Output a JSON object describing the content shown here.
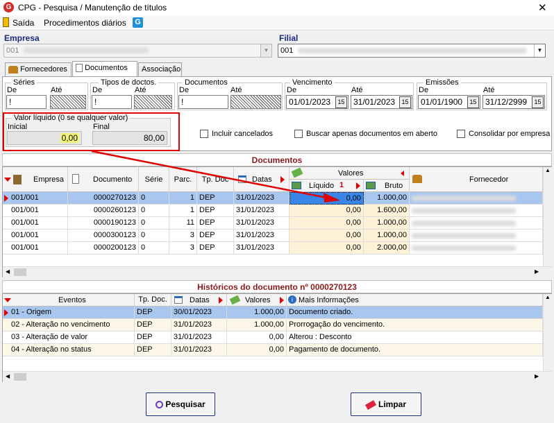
{
  "window": {
    "title": "CPG - Pesquisa / Manutenção de títulos",
    "close": "✕"
  },
  "menu": {
    "exit_label": "Saída",
    "daily_label": "Procedimentos diários"
  },
  "empresa": {
    "label": "Empresa",
    "code": "001"
  },
  "filial": {
    "label": "Filial",
    "code": "001"
  },
  "tabs": [
    {
      "label": "Fornecedores"
    },
    {
      "label": "Documentos"
    },
    {
      "label": "Associação"
    }
  ],
  "filters": {
    "series": {
      "title": "Séries",
      "de_label": "De",
      "ate_label": "Até",
      "de_value": "!",
      "ate_value": "ZZZZZ"
    },
    "tipos": {
      "title": "Tipos de doctos.",
      "de_label": "De",
      "ate_label": "Até",
      "de_value": "!",
      "ate_value": "ZZZ"
    },
    "documentos": {
      "title": "Documentos",
      "de_label": "De",
      "ate_label": "Até",
      "de_value": "!",
      "ate_value": "ZZZZZZZZZZZZ"
    },
    "vencimento": {
      "title": "Vencimento",
      "de_label": "De",
      "ate_label": "Até",
      "de_value": "01/01/2023",
      "ate_value": "31/01/2023"
    },
    "emissoes": {
      "title": "Emissões",
      "de_label": "De",
      "ate_label": "Até",
      "de_value": "01/01/1900",
      "ate_value": "31/12/2999"
    },
    "valor": {
      "title": "Valor líquido (0 se qualquer valor)",
      "inicial_label": "Inicial",
      "final_label": "Final",
      "inicial_value": "0,00",
      "final_value": "80,00"
    },
    "incluir_cancelados": "Incluir cancelados",
    "buscar_aberto": "Buscar apenas documentos em aberto",
    "consolidar": "Consolidar por empresa",
    "cal_icon": "15"
  },
  "documentos_grid": {
    "title": "Documentos",
    "headers": {
      "empresa": "Empresa",
      "documento": "Documento",
      "serie": "Série",
      "parc": "Parc.",
      "tpdoc": "Tp. Doc",
      "datas": "Datas",
      "valores": "Valores",
      "liquido": "Líquido",
      "liquido_sort": "1",
      "bruto": "Bruto",
      "fornecedor": "Fornecedor"
    },
    "rows": [
      {
        "empresa": "001/001",
        "documento": "0000270123",
        "serie": "0",
        "parc": "1",
        "tpdoc": "DEP",
        "data": "31/01/2023",
        "liquido": "0,00",
        "bruto": "1.000,00"
      },
      {
        "empresa": "001/001",
        "documento": "0000260123",
        "serie": "0",
        "parc": "1",
        "tpdoc": "DEP",
        "data": "31/01/2023",
        "liquido": "0,00",
        "bruto": "1.600,00"
      },
      {
        "empresa": "001/001",
        "documento": "0000190123",
        "serie": "0",
        "parc": "11",
        "tpdoc": "DEP",
        "data": "31/01/2023",
        "liquido": "0,00",
        "bruto": "1.000,00"
      },
      {
        "empresa": "001/001",
        "documento": "0000300123",
        "serie": "0",
        "parc": "3",
        "tpdoc": "DEP",
        "data": "31/01/2023",
        "liquido": "0,00",
        "bruto": "1.000,00"
      },
      {
        "empresa": "001/001",
        "documento": "0000200123",
        "serie": "0",
        "parc": "3",
        "tpdoc": "DEP",
        "data": "31/01/2023",
        "liquido": "0,00",
        "bruto": "2.000,00"
      }
    ]
  },
  "historico_grid": {
    "title": "Históricos do documento nº 0000270123",
    "headers": {
      "eventos": "Eventos",
      "tpdoc": "Tp. Doc.",
      "datas": "Datas",
      "valores": "Valores",
      "info": "Mais Informações"
    },
    "rows": [
      {
        "evento": "01 - Origem",
        "tpdoc": "DEP",
        "data": "30/01/2023",
        "valor": "1.000,00",
        "info": "Documento criado."
      },
      {
        "evento": "02 - Alteração no vencimento",
        "tpdoc": "DEP",
        "data": "31/01/2023",
        "valor": "1.000,00",
        "info": "Prorrogação do vencimento."
      },
      {
        "evento": "03 - Alteração de valor",
        "tpdoc": "DEP",
        "data": "31/01/2023",
        "valor": "0,00",
        "info": "Alterou : Desconto"
      },
      {
        "evento": "04 - Alteração no status",
        "tpdoc": "DEP",
        "data": "31/01/2023",
        "valor": "0,00",
        "info": "Pagamento de documento."
      }
    ]
  },
  "buttons": {
    "pesquisar": "Pesquisar",
    "limpar": "Limpar"
  },
  "colors": {
    "selected_row": "#a9c7ee",
    "highlight": "#e00000",
    "alt_row": "#fdf7e7",
    "value_cell": "#fdf2d8"
  }
}
